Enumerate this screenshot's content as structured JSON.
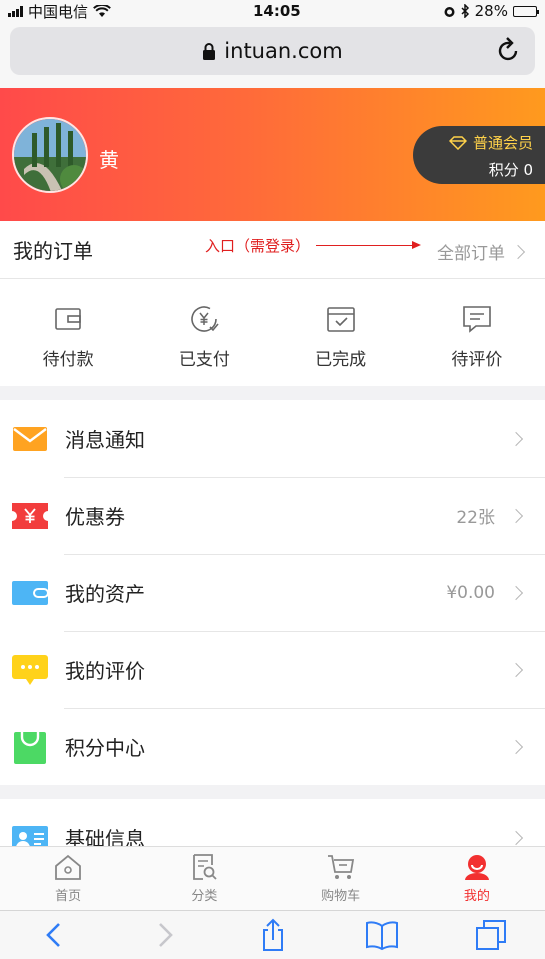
{
  "status_bar": {
    "carrier": "中国电信",
    "time": "14:05",
    "battery": "28%",
    "battery_level": 0.28
  },
  "browser": {
    "url": "intuan.com"
  },
  "profile": {
    "name": "黄",
    "member_level": "普通会员",
    "points_text": "积分 0"
  },
  "orders": {
    "title": "我的订单",
    "annotation": "入口（需登录）",
    "all_label": "全部订单",
    "items": [
      {
        "label": "待付款",
        "icon": "wallet-icon"
      },
      {
        "label": "已支付",
        "icon": "yen-coin-icon"
      },
      {
        "label": "已完成",
        "icon": "checked-box-icon"
      },
      {
        "label": "待评价",
        "icon": "comment-icon"
      }
    ]
  },
  "menu": [
    {
      "label": "消息通知",
      "value": "",
      "icon": "envelope-icon",
      "color": "#ffa321"
    },
    {
      "label": "优惠券",
      "value": "22张",
      "icon": "coupon-icon",
      "color": "#f23d3d"
    },
    {
      "label": "我的资产",
      "value": "¥0.00",
      "icon": "wallet-card-icon",
      "color": "#4db5f5"
    },
    {
      "label": "我的评价",
      "value": "",
      "icon": "chat-bubble-icon",
      "color": "#ffd21a"
    },
    {
      "label": "积分中心",
      "value": "",
      "icon": "shopping-bag-icon",
      "color": "#4cd964"
    },
    {
      "label": "基础信息",
      "value": "",
      "icon": "id-card-icon",
      "color": "#4db5f5"
    }
  ],
  "tabbar": [
    {
      "label": "首页",
      "icon": "home-icon",
      "active": false
    },
    {
      "label": "分类",
      "icon": "category-search-icon",
      "active": false
    },
    {
      "label": "购物车",
      "icon": "cart-icon",
      "active": false
    },
    {
      "label": "我的",
      "icon": "user-icon",
      "active": true
    }
  ],
  "colors": {
    "header_start": "#ff4a4a",
    "header_end": "#ff9a1e",
    "accent": "#f23030",
    "annotation": "#e02020"
  }
}
